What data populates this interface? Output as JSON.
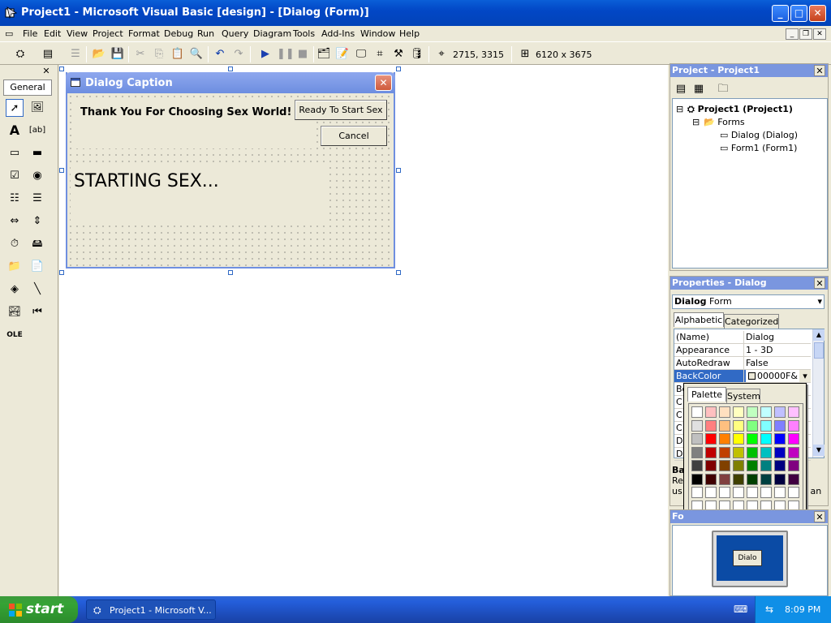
{
  "window": {
    "title": "Project1 - Microsoft Visual Basic [design] - [Dialog (Form)]",
    "min_label": "_",
    "max_label": "□",
    "close_label": "✕"
  },
  "menu": {
    "items": [
      "File",
      "Edit",
      "View",
      "Project",
      "Format",
      "Debug",
      "Run",
      "Query",
      "Diagram",
      "Tools",
      "Add-Ins",
      "Window",
      "Help"
    ]
  },
  "toolbar": {
    "position_readout": "2715, 3315",
    "size_readout": "6120 x 3675"
  },
  "toolbox": {
    "tab_label": "General",
    "close_label": "✕"
  },
  "form": {
    "caption": "Dialog Caption",
    "close_label": "✕",
    "label1": "Thank You For Choosing Sex World!",
    "label2": "STARTING SEX...",
    "ok_button": "Ready To Start Sex",
    "cancel_button": "Cancel"
  },
  "project_panel": {
    "title": "Project - Project1",
    "close_label": "✕",
    "tree": {
      "root": "Project1 (Project1)",
      "folder": "Forms",
      "form1": "Dialog (Dialog)",
      "form2": "Form1 (Form1)"
    }
  },
  "properties_panel": {
    "title": "Properties - Dialog",
    "close_label": "✕",
    "object_name": "Dialog",
    "object_type": "Form",
    "tab_alphabetic": "Alphabetic",
    "tab_categorized": "Categorized",
    "rows": [
      {
        "name": "(Name)",
        "value": "Dialog"
      },
      {
        "name": "Appearance",
        "value": "1 - 3D"
      },
      {
        "name": "AutoRedraw",
        "value": "False"
      },
      {
        "name": "BackColor",
        "value": "00000F&"
      },
      {
        "name": "Bo",
        "value": ""
      },
      {
        "name": "C",
        "value": ""
      },
      {
        "name": "C",
        "value": ""
      },
      {
        "name": "C",
        "value": ""
      },
      {
        "name": "D",
        "value": ""
      },
      {
        "name": "D",
        "value": ""
      }
    ],
    "desc_title": "Ba",
    "desc_text_1": "Re",
    "desc_text_2": "us",
    "desc_right": "n an"
  },
  "palette": {
    "tab_palette": "Palette",
    "tab_system": "System",
    "colors": [
      [
        "#ffffff",
        "#ffc0c0",
        "#ffe0c0",
        "#ffffc0",
        "#c0ffc0",
        "#c0ffff",
        "#c0c0ff",
        "#ffc0ff"
      ],
      [
        "#e0e0e0",
        "#ff8080",
        "#ffc080",
        "#ffff80",
        "#80ff80",
        "#80ffff",
        "#8080ff",
        "#ff80ff"
      ],
      [
        "#c0c0c0",
        "#ff0000",
        "#ff8000",
        "#ffff00",
        "#00ff00",
        "#00ffff",
        "#0000ff",
        "#ff00ff"
      ],
      [
        "#808080",
        "#c00000",
        "#c04000",
        "#c0c000",
        "#00c000",
        "#00c0c0",
        "#0000c0",
        "#c000c0"
      ],
      [
        "#404040",
        "#800000",
        "#804000",
        "#808000",
        "#008000",
        "#008080",
        "#000080",
        "#800080"
      ],
      [
        "#000000",
        "#400000",
        "#804040",
        "#404000",
        "#004000",
        "#004040",
        "#000040",
        "#400040"
      ],
      [
        "#ffffff",
        "#ffffff",
        "#ffffff",
        "#ffffff",
        "#ffffff",
        "#ffffff",
        "#ffffff",
        "#ffffff"
      ],
      [
        "#ffffff",
        "#ffffff",
        "#ffffff",
        "#ffffff",
        "#ffffff",
        "#ffffff",
        "#ffffff",
        "#ffffff"
      ]
    ]
  },
  "layout_panel": {
    "title": "Fo",
    "close_label": "✕",
    "preview_label": "Dialo"
  },
  "taskbar": {
    "start_label": "start",
    "task_label": "Project1 - Microsoft V...",
    "clock": "8:09 PM"
  },
  "colors": {
    "titlebar": "#0247c6",
    "form_titlebar": "#7a96df",
    "taskbar": "#245edb",
    "start": "#35a335",
    "selection": "#316ac5"
  }
}
